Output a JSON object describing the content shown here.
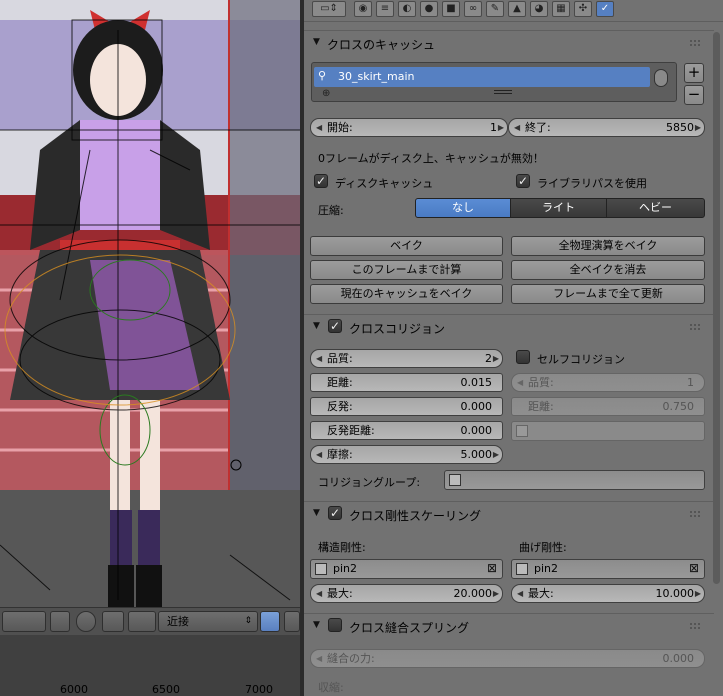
{
  "viewport": {
    "mode_select": "近接",
    "timeline_labels": [
      "6000",
      "6500",
      "7000"
    ]
  },
  "context_tabs": [
    "render",
    "layers",
    "scene",
    "world",
    "object",
    "constraints",
    "modifiers",
    "data",
    "material",
    "texture",
    "particles",
    "physics"
  ],
  "cache": {
    "title": "クロスのキャッシュ",
    "cache_item": "30_skirt_main",
    "start_label": "開始:",
    "start_value": "1",
    "end_label": "終了:",
    "end_value": "5850",
    "info": "0フレームがディスク上、キャッシュが無効！",
    "disk_cache_label": "ディスクキャッシュ",
    "disk_cache_checked": true,
    "library_path_label": "ライブラリパスを使用",
    "library_path_checked": true,
    "compression_label": "圧縮:",
    "compression_options": [
      "なし",
      "ライト",
      "ヘビー"
    ],
    "compression_selected": "なし",
    "buttons": {
      "bake": "ベイク",
      "bake_all": "全物理演算をベイク",
      "calc_to_frame": "このフレームまで計算",
      "free_all": "全ベイクを消去",
      "current_cache_to_bake": "現在のキャッシュをベイク",
      "update_all_to_frame": "フレームまで全て更新"
    }
  },
  "collision": {
    "title": "クロスコリジョン",
    "enabled": true,
    "quality_label": "品質:",
    "quality_value": "2",
    "distance_label": "距離:",
    "distance_value": "0.015",
    "repel_label": "反発:",
    "repel_value": "0.000",
    "repel_distance_label": "反発距離:",
    "repel_distance_value": "0.000",
    "friction_label": "摩擦:",
    "friction_value": "5.000",
    "self_collision_label": "セルフコリジョン",
    "self_collision_checked": false,
    "self_quality_label": "品質:",
    "self_quality_value": "1",
    "self_distance_label": "距離:",
    "self_distance_value": "0.750",
    "collision_group_label": "コリジョングループ:"
  },
  "stiffness": {
    "title": "クロス剛性スケーリング",
    "enabled": true,
    "structural_label": "構造剛性:",
    "structural_group": "pin2",
    "structural_max_label": "最大:",
    "structural_max_value": "20.000",
    "bending_label": "曲げ剛性:",
    "bending_group": "pin2",
    "bending_max_label": "最大:",
    "bending_max_value": "10.000"
  },
  "sewing": {
    "title": "クロス縫合スプリング",
    "enabled": false,
    "force_label": "縫合の力:",
    "force_value": "0.000",
    "shrink_label": "収縮:"
  },
  "colors": {
    "panel_bg": "#727272",
    "selected_blue": "#5680c2",
    "field_bg": "#b0b0b0"
  }
}
